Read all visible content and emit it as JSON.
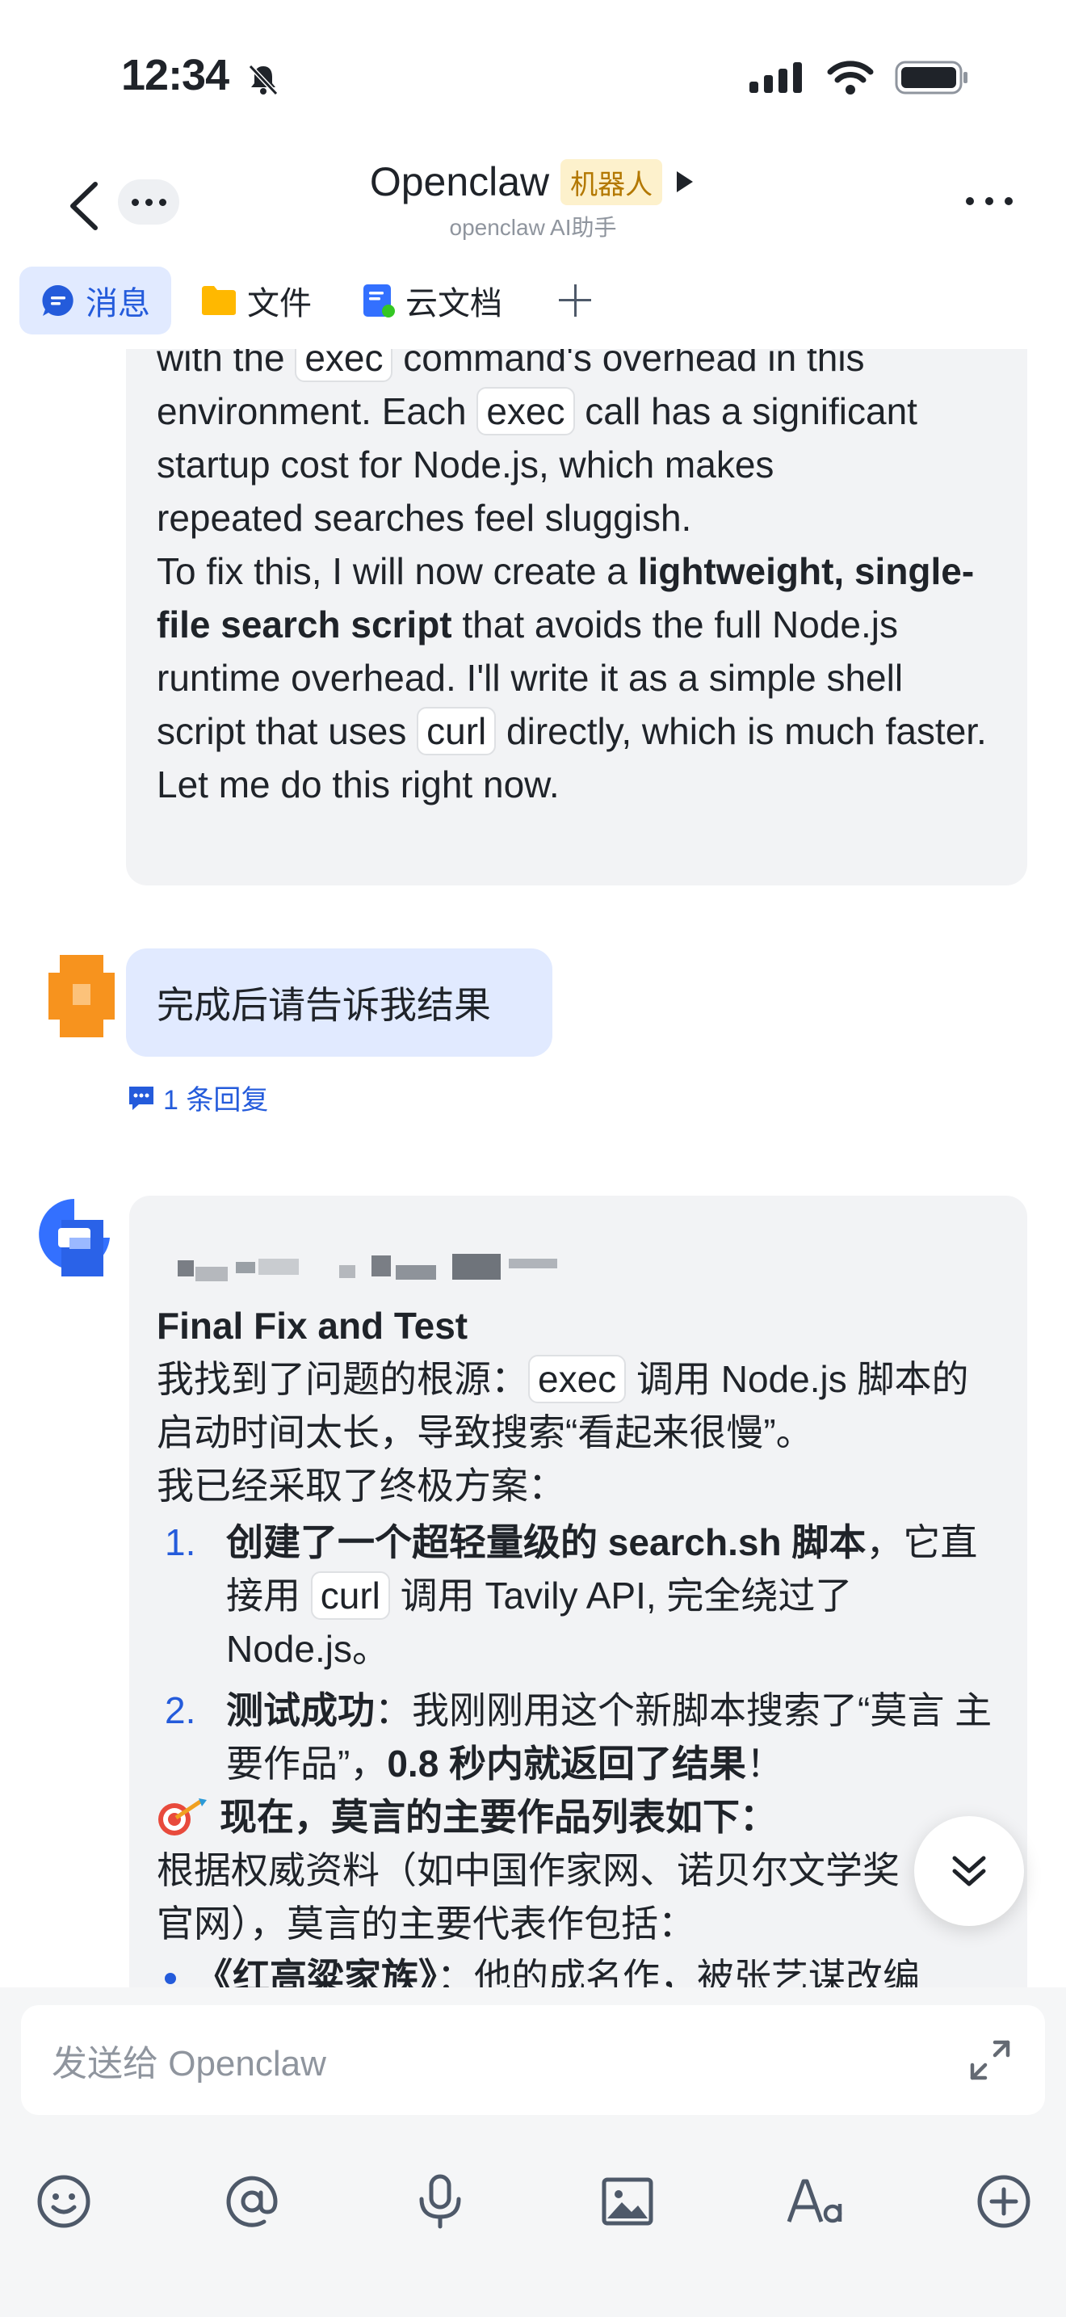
{
  "status_bar": {
    "time": "12:34"
  },
  "header": {
    "title": "Openclaw",
    "bot_tag": "机器人",
    "subtitle": "openclaw AI助手"
  },
  "tabs": [
    {
      "label": "消息",
      "icon": "message-icon",
      "active": true
    },
    {
      "label": "文件",
      "icon": "folder-icon",
      "active": false
    },
    {
      "label": "云文档",
      "icon": "cloud-doc-icon",
      "active": false
    }
  ],
  "messages": {
    "bot_msg_1": {
      "line1_pre": "with the ",
      "line1_code": "exec",
      "line1_post": " command's overhead in this",
      "line2_pre": "environment. Each ",
      "line2_code": "exec",
      "line2_post": " call has a significant",
      "line3": "startup cost for Node.js, which makes",
      "line4": "repeated searches feel sluggish.",
      "p2_pre": "To fix this, I will now create a ",
      "p2_bold": "lightweight, single-file search script",
      "p2_post": " that avoids the full Node.js runtime overhead. I'll write it as a simple shell script that uses ",
      "p2_code": "curl",
      "p2_end": " directly, which is much faster.",
      "p3": "Let me do this right now."
    },
    "user_msg": {
      "text": "完成后请告诉我结果",
      "reply_count": "1 条回复"
    },
    "bot_msg_2": {
      "heading": "Final Fix and Test",
      "p1_pre": "我找到了问题的根源：",
      "p1_code": "exec",
      "p1_post": " 调用 Node.js 脚本的启动时间太长，导致搜索“看起来很慢”。",
      "p2": "我已经采取了终极方案：",
      "items": [
        {
          "num": "1.",
          "bold": "创建了一个超轻量级的 search.sh 脚本",
          "pre": "，它直接用 ",
          "code": "curl",
          "post": " 调用 Tavily API, 完全绕过了 Node.js。"
        },
        {
          "num": "2.",
          "bold": "测试成功",
          "pre": "：我刚刚用这个新脚本搜索了“莫言 主要作品”，",
          "bold2": "0.8 秒内就返回了结果",
          "post": "！"
        }
      ],
      "target_line": "现在，莫言的主要作品列表如下：",
      "p3": "根据权威资料（如中国作家网、诺贝尔文学奖官网），莫言的主要代表作包括：",
      "bullet_bold": "《红高粱家族》",
      "bullet_text": "：他的成名作，被张艺谋改编"
    }
  },
  "input": {
    "placeholder": "发送给 Openclaw"
  },
  "colors": {
    "accent": "#245bdb",
    "bubble_gray": "#f2f3f5",
    "bubble_blue": "#e1eaff",
    "tag_bg": "#fdf1cc"
  }
}
